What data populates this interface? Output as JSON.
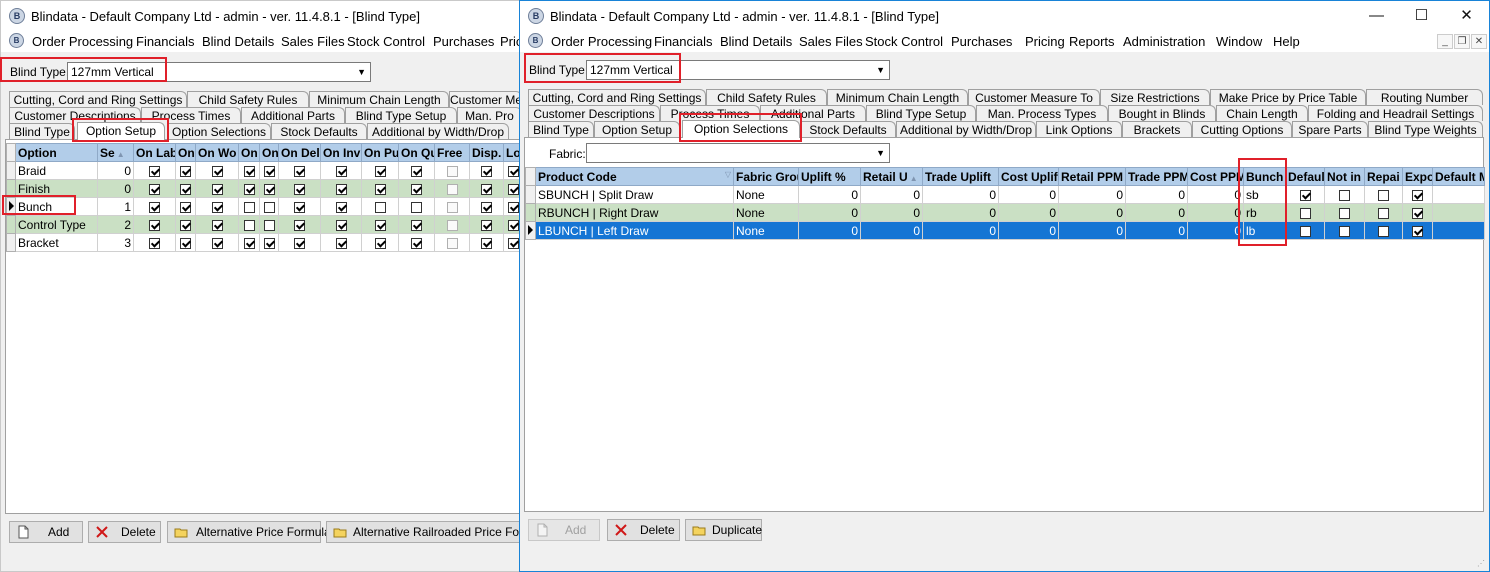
{
  "window_left": {
    "title": "Blindata - Default Company Ltd - admin - ver. 11.4.8.1 - [Blind Type]",
    "menu": [
      "Order Processing",
      "Financials",
      "Blind Details",
      "Sales Files",
      "Stock Control",
      "Purchases",
      "Pric"
    ],
    "blind_type_label": "Blind Type:",
    "blind_type_value": "127mm Vertical",
    "tabs_row1": [
      "Cutting, Cord and Ring Settings",
      "Child Safety Rules",
      "Minimum Chain Length",
      "Customer Me"
    ],
    "tabs_row2": [
      "Customer Descriptions",
      "Process Times",
      "Additional Parts",
      "Blind Type Setup",
      "Man. Pro"
    ],
    "tabs_row3": [
      "Blind Type",
      "Option Setup",
      "Option Selections",
      "Stock Defaults",
      "Additional by Width/Drop"
    ],
    "active_tab": "Option Setup",
    "grid_headers": [
      "Option",
      "Se",
      "On Lab",
      "On",
      "On Wo",
      "On",
      "On",
      "On Del",
      "On Inv",
      "On Pu",
      "On Qu",
      "Free",
      "Disp.",
      "Loc"
    ],
    "rows": [
      {
        "option": "Braid",
        "seq": "0",
        "checks": [
          1,
          1,
          1,
          1,
          1,
          1,
          1,
          1,
          1,
          0,
          1,
          1
        ]
      },
      {
        "option": "Finish",
        "seq": "0",
        "checks": [
          1,
          1,
          1,
          1,
          1,
          1,
          1,
          1,
          1,
          0,
          1,
          1
        ]
      },
      {
        "option": "Bunch",
        "seq": "1",
        "checks": [
          1,
          1,
          1,
          0,
          0,
          1,
          1,
          0,
          0,
          0,
          1,
          1
        ]
      },
      {
        "option": "Control Type",
        "seq": "2",
        "checks": [
          1,
          1,
          1,
          0,
          0,
          1,
          1,
          1,
          1,
          0,
          1,
          1
        ]
      },
      {
        "option": "Bracket",
        "seq": "3",
        "checks": [
          1,
          1,
          1,
          1,
          1,
          1,
          1,
          1,
          1,
          0,
          1,
          1
        ]
      }
    ],
    "buttons": {
      "add": "Add",
      "delete": "Delete",
      "alt_price": "Alternative Price Formula",
      "alt_railroaded": "Alternative Railroaded Price Formula"
    }
  },
  "window_right": {
    "title": "Blindata - Default Company Ltd - admin - ver. 11.4.8.1 - [Blind Type]",
    "menu": [
      "Order Processing",
      "Financials",
      "Blind Details",
      "Sales Files",
      "Stock Control",
      "Purchases",
      "Pricing",
      "Reports",
      "Administration",
      "Window",
      "Help"
    ],
    "blind_type_label": "Blind Type:",
    "blind_type_value": "127mm Vertical",
    "tabs_row1": [
      "Cutting, Cord and Ring Settings",
      "Child Safety Rules",
      "Minimum Chain Length",
      "Customer Measure To",
      "Size Restrictions",
      "Make Price by Price Table",
      "Routing Number"
    ],
    "tabs_row2": [
      "Customer Descriptions",
      "Process Times",
      "Additional Parts",
      "Blind Type Setup",
      "Man. Process Types",
      "Bought in Blinds",
      "Chain Length",
      "Folding and Headrail Settings"
    ],
    "tabs_row3": [
      "Blind Type",
      "Option Setup",
      "Option Selections",
      "Stock Defaults",
      "Additional by Width/Drop",
      "Link Options",
      "Brackets",
      "Cutting Options",
      "Spare Parts",
      "Blind Type Weights"
    ],
    "active_tab": "Option Selections",
    "fabric_label": "Fabric:",
    "fabric_value": "",
    "grid_headers": [
      "Product Code",
      "Fabric Grou",
      "Uplift %",
      "Retail U",
      "Trade Uplift",
      "Cost Uplift",
      "Retail PPM",
      "Trade PPM",
      "Cost PPM",
      "Bunch",
      "Defaul",
      "Not in",
      "Repai",
      "Expo",
      "Default M"
    ],
    "rows": [
      {
        "code": "SBUNCH | Split Draw",
        "fabric_group": "None",
        "uplift": "0",
        "retail_u": "0",
        "trade_uplift": "0",
        "cost_uplift": "0",
        "retail_ppm": "0",
        "trade_ppm": "0",
        "cost_ppm": "0",
        "bunch": "sb",
        "checks": [
          1,
          0,
          0,
          1
        ]
      },
      {
        "code": "RBUNCH | Right Draw",
        "fabric_group": "None",
        "uplift": "0",
        "retail_u": "0",
        "trade_uplift": "0",
        "cost_uplift": "0",
        "retail_ppm": "0",
        "trade_ppm": "0",
        "cost_ppm": "0",
        "bunch": "rb",
        "checks": [
          0,
          0,
          0,
          1
        ]
      },
      {
        "code": "LBUNCH | Left Draw",
        "fabric_group": "None",
        "uplift": "0",
        "retail_u": "0",
        "trade_uplift": "0",
        "cost_uplift": "0",
        "retail_ppm": "0",
        "trade_ppm": "0",
        "cost_ppm": "0",
        "bunch": "lb",
        "checks": [
          0,
          0,
          0,
          1
        ]
      }
    ],
    "buttons": {
      "add": "Add",
      "delete": "Delete",
      "duplicate": "Duplicate"
    }
  },
  "colors": {
    "highlight": "#e0202a",
    "selected_row": "#1575d4",
    "alt_row": "#cae0c4",
    "header": "#b2cde9"
  }
}
